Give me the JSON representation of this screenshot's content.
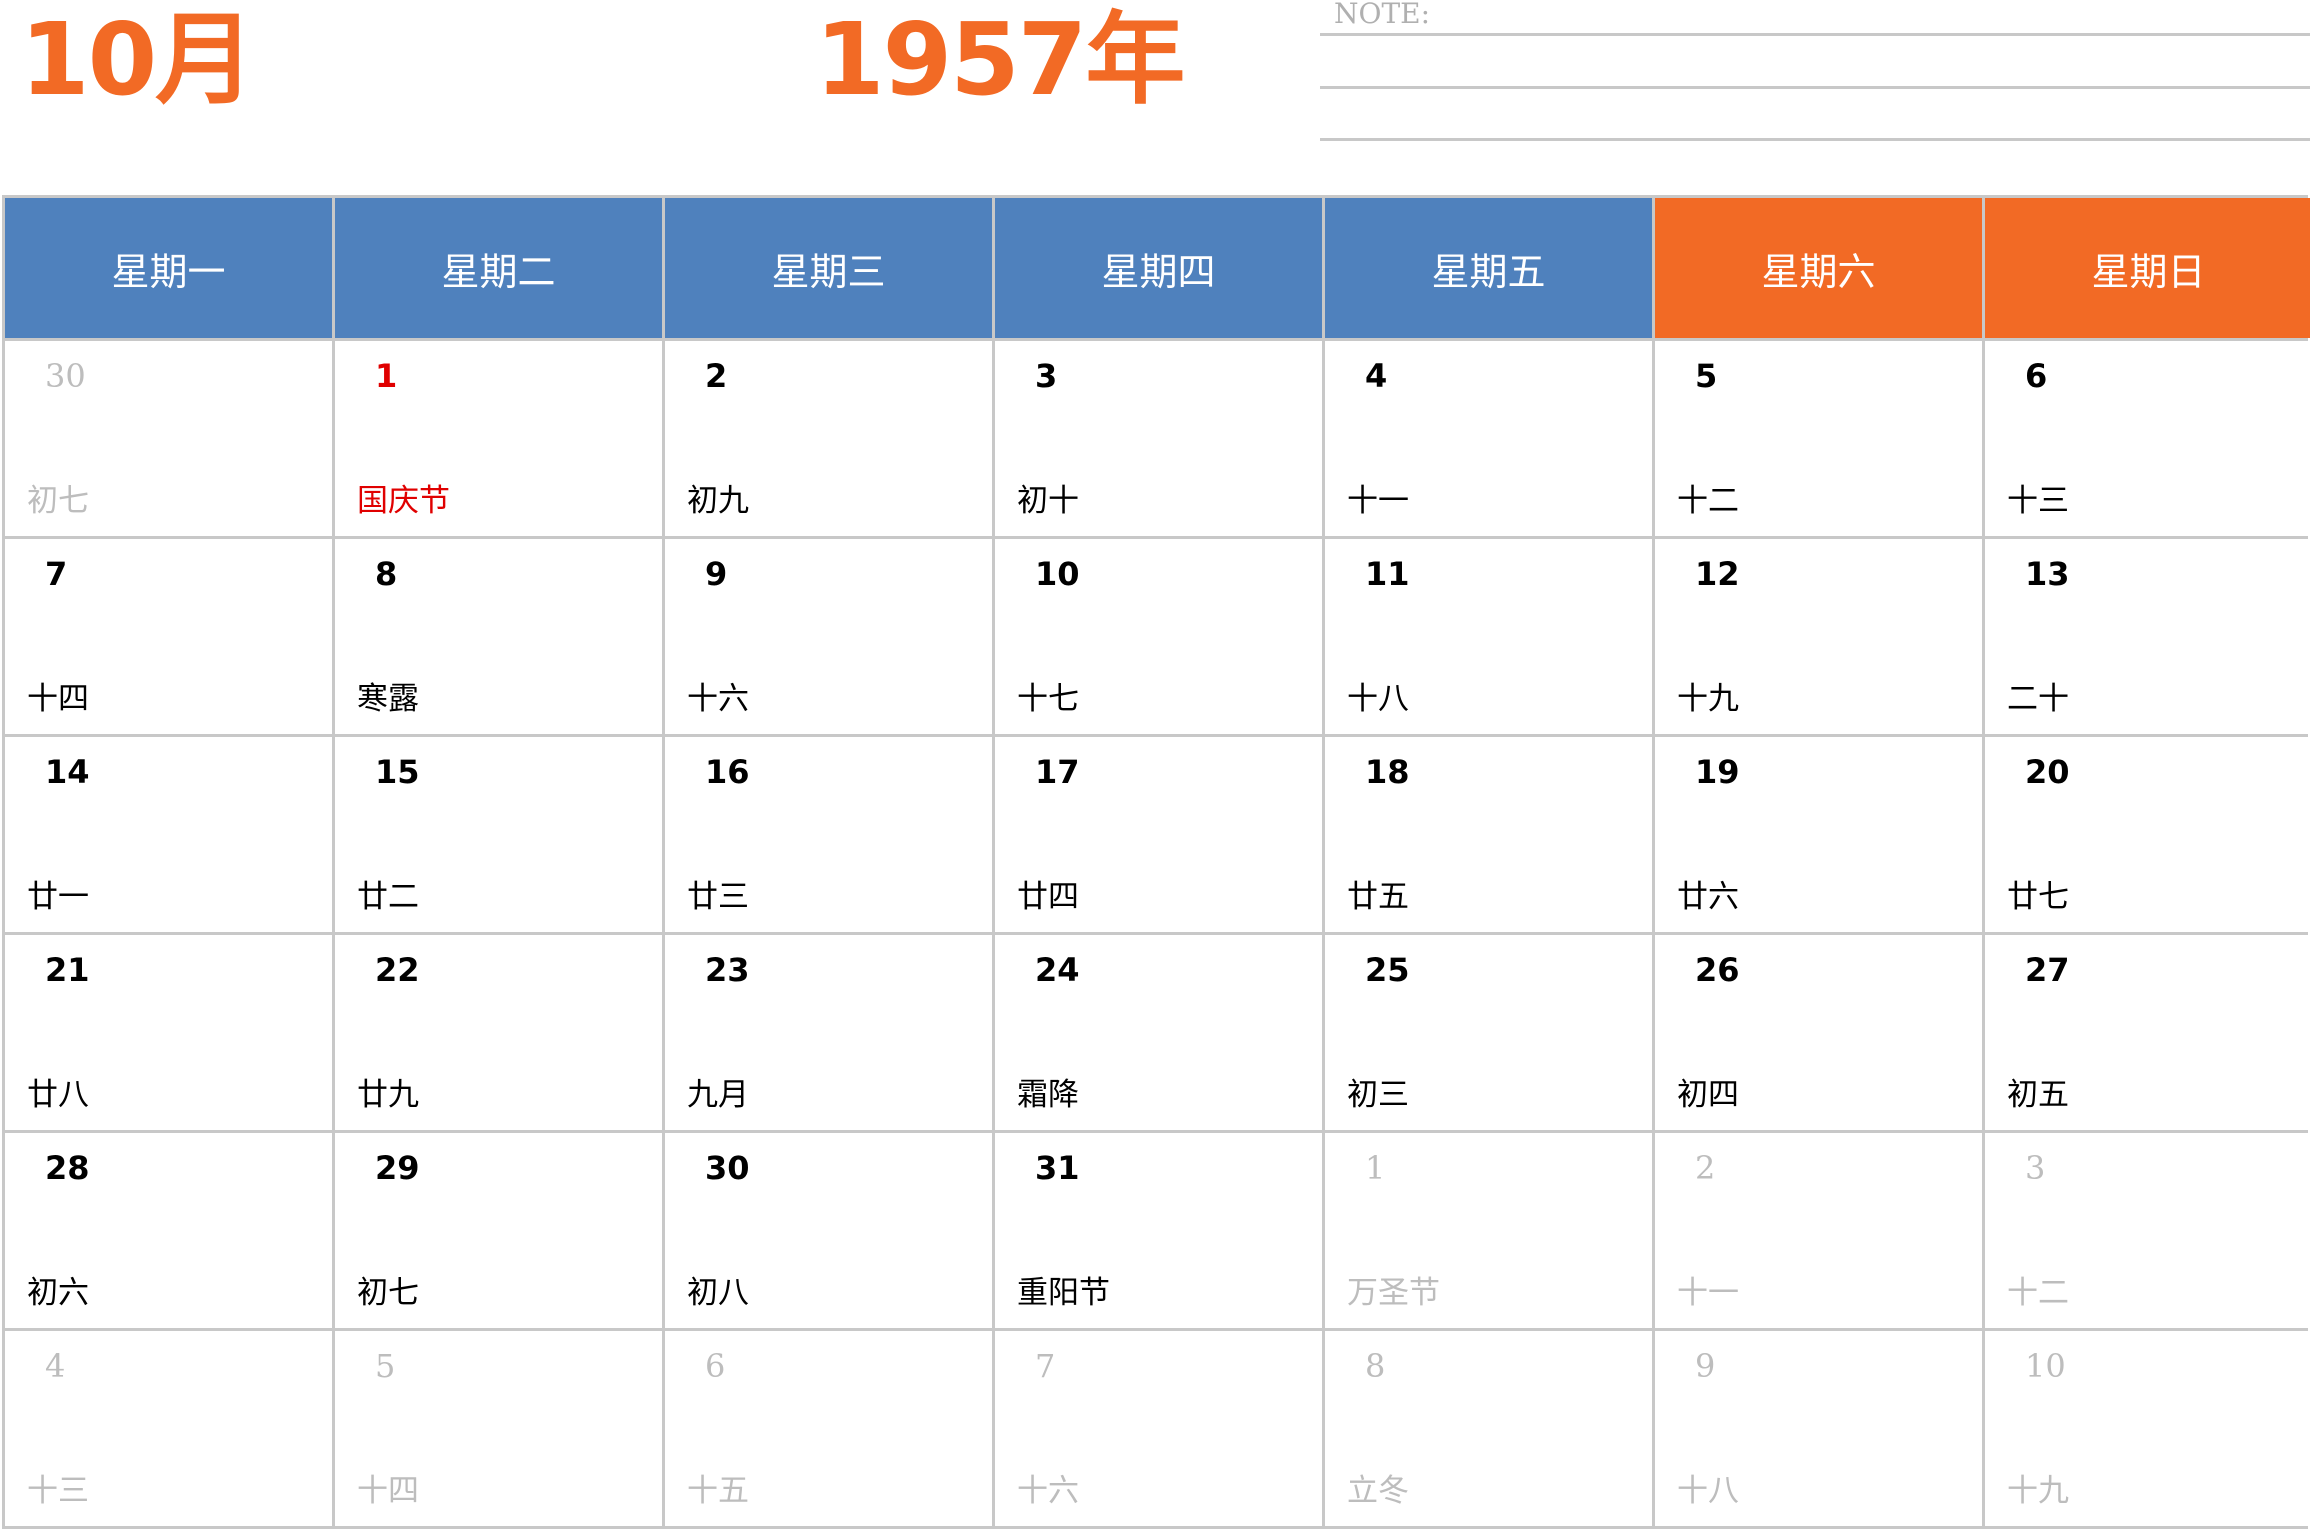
{
  "header": {
    "month": "10月",
    "year": "1957年",
    "note_label": "NOTE:"
  },
  "weekdays": [
    "星期一",
    "星期二",
    "星期三",
    "星期四",
    "星期五",
    "星期六",
    "星期日"
  ],
  "colors": {
    "accent": "#f26a25",
    "weekday_header": "#4f81bd",
    "weekend_header": "#f26a25",
    "holiday": "#e00000",
    "other_month": "#bdbdbd"
  },
  "weeks": [
    [
      {
        "day": "30",
        "lunar": "初七",
        "type": "other"
      },
      {
        "day": "1",
        "lunar": "国庆节",
        "type": "holiday"
      },
      {
        "day": "2",
        "lunar": "初九",
        "type": "normal"
      },
      {
        "day": "3",
        "lunar": "初十",
        "type": "normal"
      },
      {
        "day": "4",
        "lunar": "十一",
        "type": "normal"
      },
      {
        "day": "5",
        "lunar": "十二",
        "type": "normal"
      },
      {
        "day": "6",
        "lunar": "十三",
        "type": "normal"
      }
    ],
    [
      {
        "day": "7",
        "lunar": "十四",
        "type": "normal"
      },
      {
        "day": "8",
        "lunar": "寒露",
        "type": "normal"
      },
      {
        "day": "9",
        "lunar": "十六",
        "type": "normal"
      },
      {
        "day": "10",
        "lunar": "十七",
        "type": "normal"
      },
      {
        "day": "11",
        "lunar": "十八",
        "type": "normal"
      },
      {
        "day": "12",
        "lunar": "十九",
        "type": "normal"
      },
      {
        "day": "13",
        "lunar": "二十",
        "type": "normal"
      }
    ],
    [
      {
        "day": "14",
        "lunar": "廿一",
        "type": "normal"
      },
      {
        "day": "15",
        "lunar": "廿二",
        "type": "normal"
      },
      {
        "day": "16",
        "lunar": "廿三",
        "type": "normal"
      },
      {
        "day": "17",
        "lunar": "廿四",
        "type": "normal"
      },
      {
        "day": "18",
        "lunar": "廿五",
        "type": "normal"
      },
      {
        "day": "19",
        "lunar": "廿六",
        "type": "normal"
      },
      {
        "day": "20",
        "lunar": "廿七",
        "type": "normal"
      }
    ],
    [
      {
        "day": "21",
        "lunar": "廿八",
        "type": "normal"
      },
      {
        "day": "22",
        "lunar": "廿九",
        "type": "normal"
      },
      {
        "day": "23",
        "lunar": "九月",
        "type": "normal"
      },
      {
        "day": "24",
        "lunar": "霜降",
        "type": "normal"
      },
      {
        "day": "25",
        "lunar": "初三",
        "type": "normal"
      },
      {
        "day": "26",
        "lunar": "初四",
        "type": "normal"
      },
      {
        "day": "27",
        "lunar": "初五",
        "type": "normal"
      }
    ],
    [
      {
        "day": "28",
        "lunar": "初六",
        "type": "normal"
      },
      {
        "day": "29",
        "lunar": "初七",
        "type": "normal"
      },
      {
        "day": "30",
        "lunar": "初八",
        "type": "normal"
      },
      {
        "day": "31",
        "lunar": "重阳节",
        "type": "normal"
      },
      {
        "day": "1",
        "lunar": "万圣节",
        "type": "other"
      },
      {
        "day": "2",
        "lunar": "十一",
        "type": "other"
      },
      {
        "day": "3",
        "lunar": "十二",
        "type": "other"
      }
    ],
    [
      {
        "day": "4",
        "lunar": "十三",
        "type": "other"
      },
      {
        "day": "5",
        "lunar": "十四",
        "type": "other"
      },
      {
        "day": "6",
        "lunar": "十五",
        "type": "other"
      },
      {
        "day": "7",
        "lunar": "十六",
        "type": "other"
      },
      {
        "day": "8",
        "lunar": "立冬",
        "type": "other"
      },
      {
        "day": "9",
        "lunar": "十八",
        "type": "other"
      },
      {
        "day": "10",
        "lunar": "十九",
        "type": "other"
      }
    ]
  ]
}
